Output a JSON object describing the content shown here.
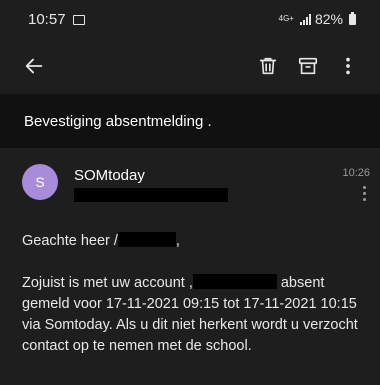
{
  "status_bar": {
    "time": "10:57",
    "network_label": "4G+",
    "battery": "82%"
  },
  "toolbar": {
    "back_icon": "arrow-back-icon",
    "delete_icon": "trash-icon",
    "archive_icon": "archive-icon",
    "more_icon": "more-vert-icon"
  },
  "email": {
    "subject": "Bevestiging absentmelding .",
    "sender_name": "SOMtoday",
    "avatar_initial": "S",
    "time": "10:26",
    "greeting_pre": "Geachte heer /",
    "greeting_post": ",",
    "body_part1": "Zojuist is met uw account ,",
    "body_part2": " absent gemeld voor 17-11-2021 09:15 tot 17-11-2021 10:15 via Somtoday. Als u dit niet herkent wordt u verzocht contact op te nemen met de school."
  },
  "colors": {
    "background": "#1e1e1e",
    "subject_bar": "#111111",
    "avatar": "#a88cd9",
    "text": "#e8e8e8",
    "muted": "#9a9a9a"
  }
}
